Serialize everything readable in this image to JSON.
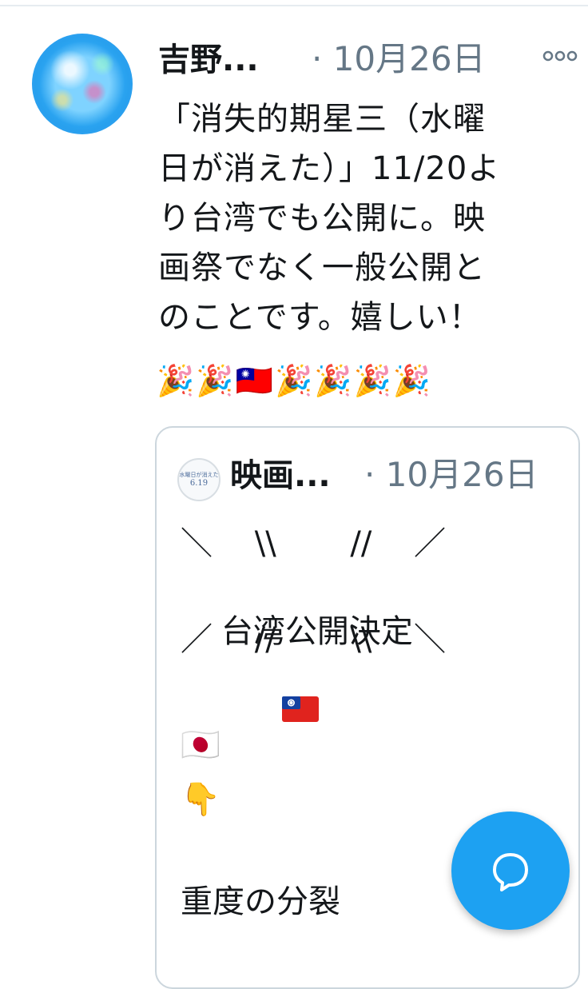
{
  "tweet": {
    "author_name": "吉野...",
    "time": "· 10月26日",
    "text_lines": [
      "「消失的期星三（水曜",
      "日が消えた）」11/20よ",
      "り台湾でも公開に。映",
      "画祭でなく一般公開と",
      "のことです。嬉しい！"
    ],
    "emoji_row": "🎉🎉🇹🇼🎉🎉🎉🎉"
  },
  "quote": {
    "avatar_text_top": "水曜日が消えた",
    "avatar_text_bottom": "6.19",
    "author_name": "映画...",
    "time": "· 10月26日",
    "deco_top": "＼　 \\\\　 　//　 ／",
    "headline": "台湾公開決定",
    "deco_bottom": "／　 //　 　\\\\　 ＼",
    "flag_emoji": "🇯🇵",
    "pointing_emoji": "👇",
    "last_line": "重度の分裂"
  },
  "icons": {
    "more": "more-horizontal-icon",
    "compose": "chat-bubble-icon"
  },
  "colors": {
    "accent": "#1da1f2",
    "muted_text": "#657786",
    "border": "#ccd6dd"
  }
}
